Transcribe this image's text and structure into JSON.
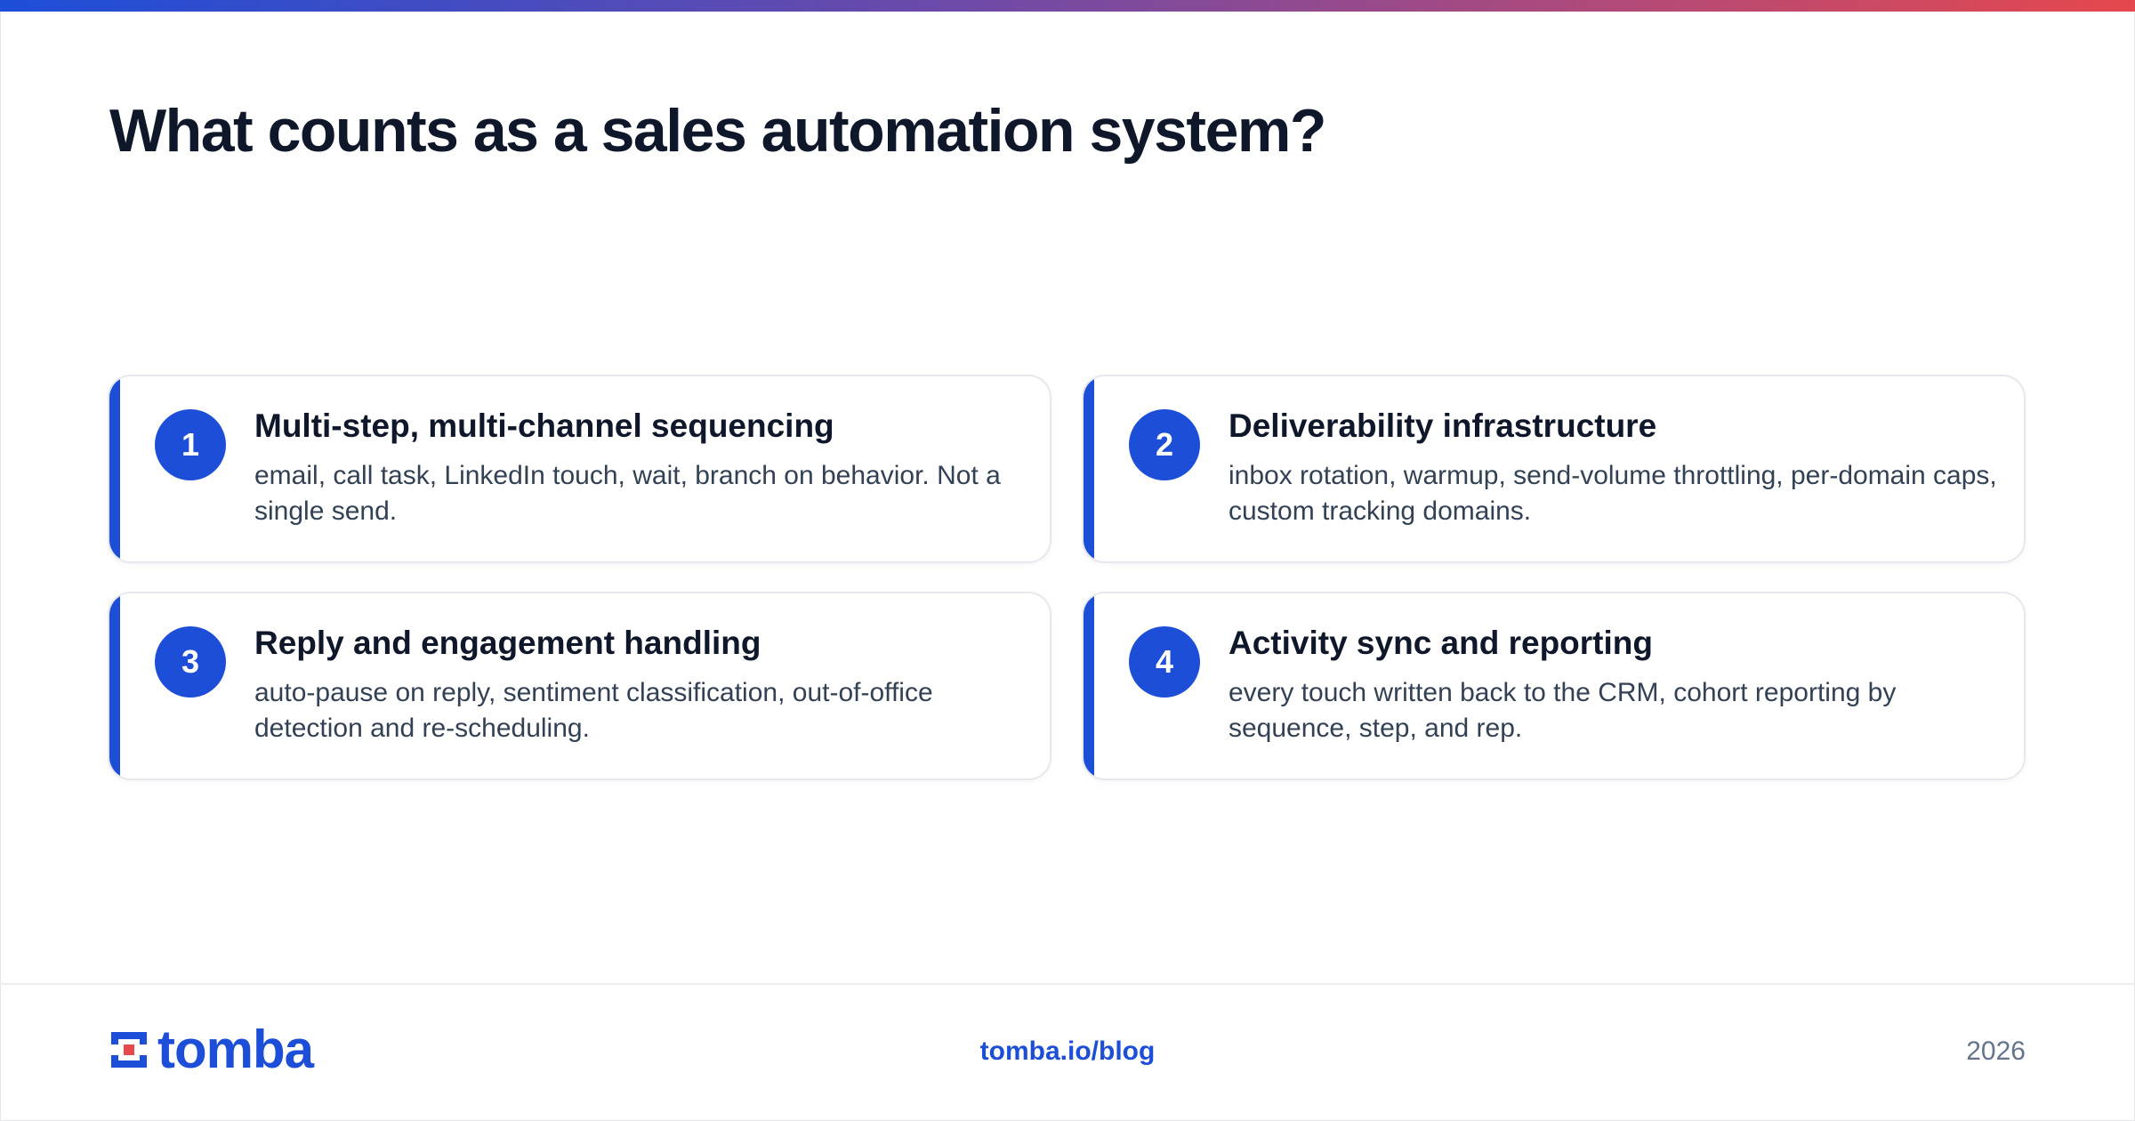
{
  "page": {
    "title": "What counts as a sales automation system?"
  },
  "cards": [
    {
      "number": "1",
      "heading": "Multi-step, multi-channel sequencing",
      "description": "email, call task, LinkedIn touch, wait, branch on behavior. Not a single send."
    },
    {
      "number": "2",
      "heading": "Deliverability infrastructure",
      "description": "inbox rotation, warmup, send-volume throttling, per-domain caps, custom tracking domains."
    },
    {
      "number": "3",
      "heading": "Reply and engagement handling",
      "description": "auto-pause on reply, sentiment classification, out-of-office detection and re-scheduling."
    },
    {
      "number": "4",
      "heading": "Activity sync and reporting",
      "description": "every touch written back to the CRM, cohort reporting by sequence, step, and rep."
    }
  ],
  "footer": {
    "logo_text": "tomba",
    "link": "tomba.io/blog",
    "year": "2026"
  },
  "colors": {
    "accent": "#1d4ed8",
    "logo_red": "#e5484d",
    "heading": "#0f172a",
    "body": "#334155",
    "muted": "#64748b"
  },
  "icons": {
    "logo_mark": "tomba-logo-icon"
  }
}
